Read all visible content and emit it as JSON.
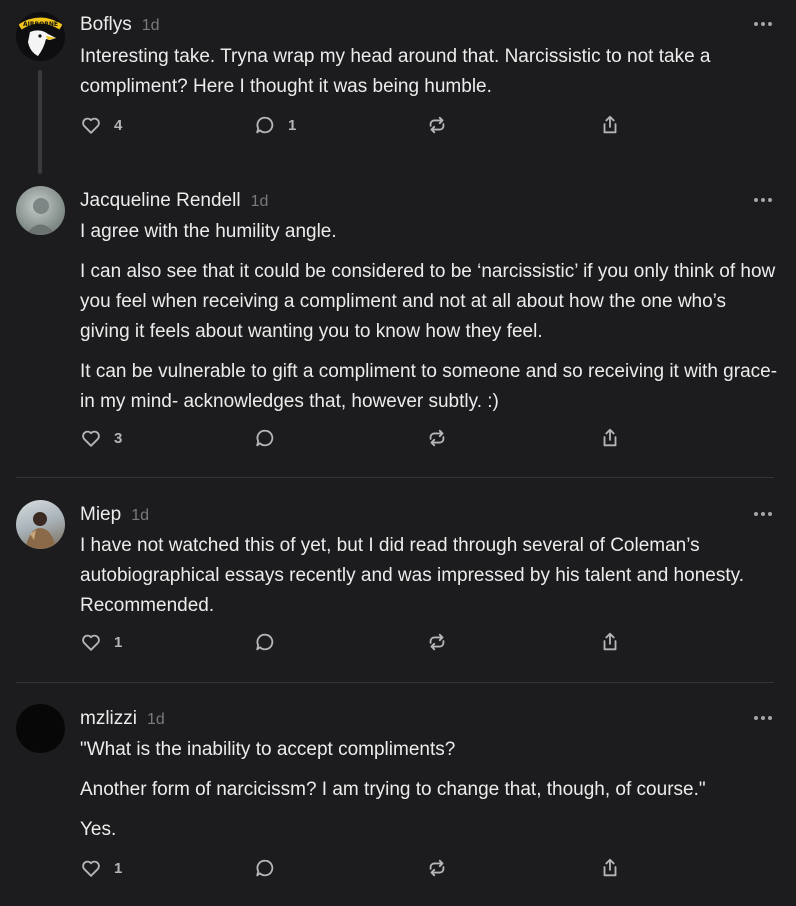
{
  "colors": {
    "background": "#1c1c1e",
    "text": "#ececec",
    "muted": "#7a7a7e",
    "icon": "#b5b5b8",
    "divider": "#343437"
  },
  "comments": [
    {
      "author": "Boflys",
      "time": "1d",
      "avatar_text": "AIRBORNE",
      "paragraphs": [
        "Interesting take. Tryna wrap my head around that. Narcissistic to not take a compliment? Here I thought it was being humble."
      ],
      "likes": "4",
      "replies": "1"
    },
    {
      "author": "Jacqueline Rendell",
      "time": "1d",
      "paragraphs": [
        "I agree with the humility angle.",
        "I can also see that it could be considered to be ‘narcissistic’ if you only think of how you feel when receiving a compliment and not at all about how the one who’s giving it feels about wanting you to know how they feel.",
        "It can be vulnerable to gift a compliment to someone and so receiving it with grace- in my mind- acknowledges that, however subtly. :)"
      ],
      "likes": "3",
      "replies": ""
    },
    {
      "author": "Miep",
      "time": "1d",
      "paragraphs": [
        "I have not watched this of yet, but I did read through several of Coleman’s autobiographical essays recently and was impressed by his talent and honesty. Recommended."
      ],
      "likes": "1",
      "replies": ""
    },
    {
      "author": "mzlizzi",
      "time": "1d",
      "paragraphs": [
        "\"What is the inability to accept compliments?",
        "Another form of narcicissm? I am trying to change that, though, of course.\"",
        "Yes."
      ],
      "likes": "1",
      "replies": ""
    }
  ]
}
